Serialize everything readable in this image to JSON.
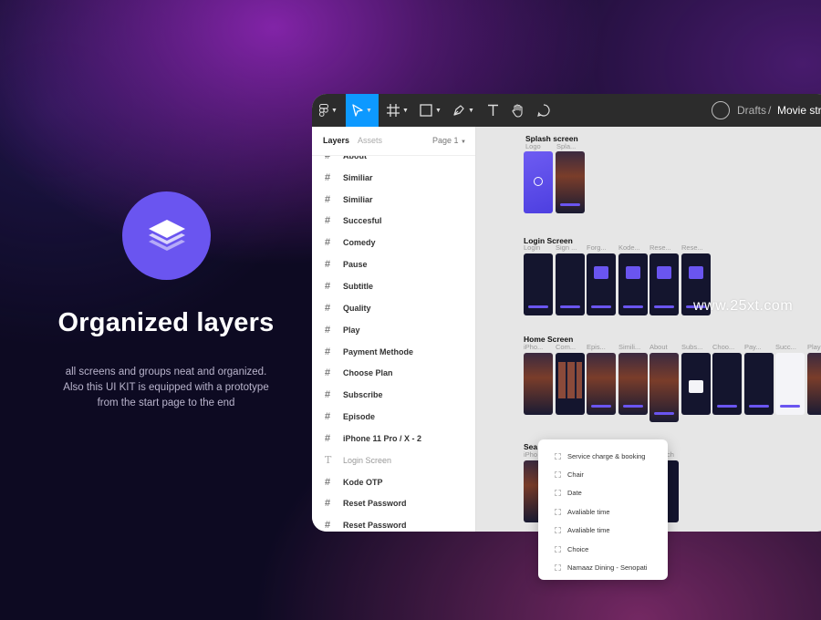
{
  "promo": {
    "icon": "layers-icon",
    "title": "Organized layers",
    "description": [
      "all screens and groups neat and organized.",
      "Also this UI KIT is equipped with a prototype",
      "from the start page to the end"
    ],
    "accent": "#6a55f0"
  },
  "toolbar": {
    "tools": [
      "figma-menu-icon",
      "move-tool-icon",
      "frame-tool-icon",
      "shape-tool-icon",
      "pen-tool-icon",
      "text-tool-icon",
      "hand-tool-icon",
      "comment-tool-icon"
    ],
    "active_tool": "move-tool-icon",
    "breadcrumb_drafts": "Drafts",
    "breadcrumb_sep": "/",
    "file_name": "Movie stre",
    "active_color": "#0d99ff"
  },
  "layers_panel": {
    "tab_layers": "Layers",
    "tab_assets": "Assets",
    "page": "Page 1",
    "items": [
      {
        "label": "About",
        "kind": "frame"
      },
      {
        "label": "Similiar",
        "kind": "frame"
      },
      {
        "label": "Similiar",
        "kind": "frame"
      },
      {
        "label": "Succesful",
        "kind": "frame"
      },
      {
        "label": "Comedy",
        "kind": "frame"
      },
      {
        "label": "Pause",
        "kind": "frame"
      },
      {
        "label": "Subtitle",
        "kind": "frame"
      },
      {
        "label": "Quality",
        "kind": "frame"
      },
      {
        "label": "Play",
        "kind": "frame"
      },
      {
        "label": "Payment Methode",
        "kind": "frame"
      },
      {
        "label": "Choose Plan",
        "kind": "frame"
      },
      {
        "label": "Subscribe",
        "kind": "frame"
      },
      {
        "label": "Episode",
        "kind": "frame"
      },
      {
        "label": "iPhone 11 Pro / X - 2",
        "kind": "frame"
      },
      {
        "label": "Login Screen",
        "kind": "text"
      },
      {
        "label": "Kode OTP",
        "kind": "frame"
      },
      {
        "label": "Reset Password",
        "kind": "frame"
      },
      {
        "label": "Reset Password",
        "kind": "frame"
      }
    ]
  },
  "canvas": {
    "splash": {
      "title": "Splash screen",
      "labels": [
        "Logo",
        "Spla..."
      ]
    },
    "login": {
      "title": "Login Screen",
      "labels": [
        "Login",
        "Sign ...",
        "Forg...",
        "Kode...",
        "Rese...",
        "Rese..."
      ]
    },
    "home": {
      "title": "Home Screen",
      "labels": [
        "iPho...",
        "Com...",
        "Epis...",
        "Simili...",
        "About",
        "Subs...",
        "Choo...",
        "Pay...",
        "Succ...",
        "Play"
      ]
    },
    "search": {
      "title": "Sea",
      "labels": [
        "iPho"
      ],
      "label_right": "ch"
    },
    "watermark": "www.25xt.com"
  },
  "popup": {
    "items": [
      "Service charge & booking",
      "Chair",
      "Date",
      "Avaliable time",
      "Avaliable time",
      "Choice",
      "Namaaz Dining - Senopati"
    ]
  }
}
